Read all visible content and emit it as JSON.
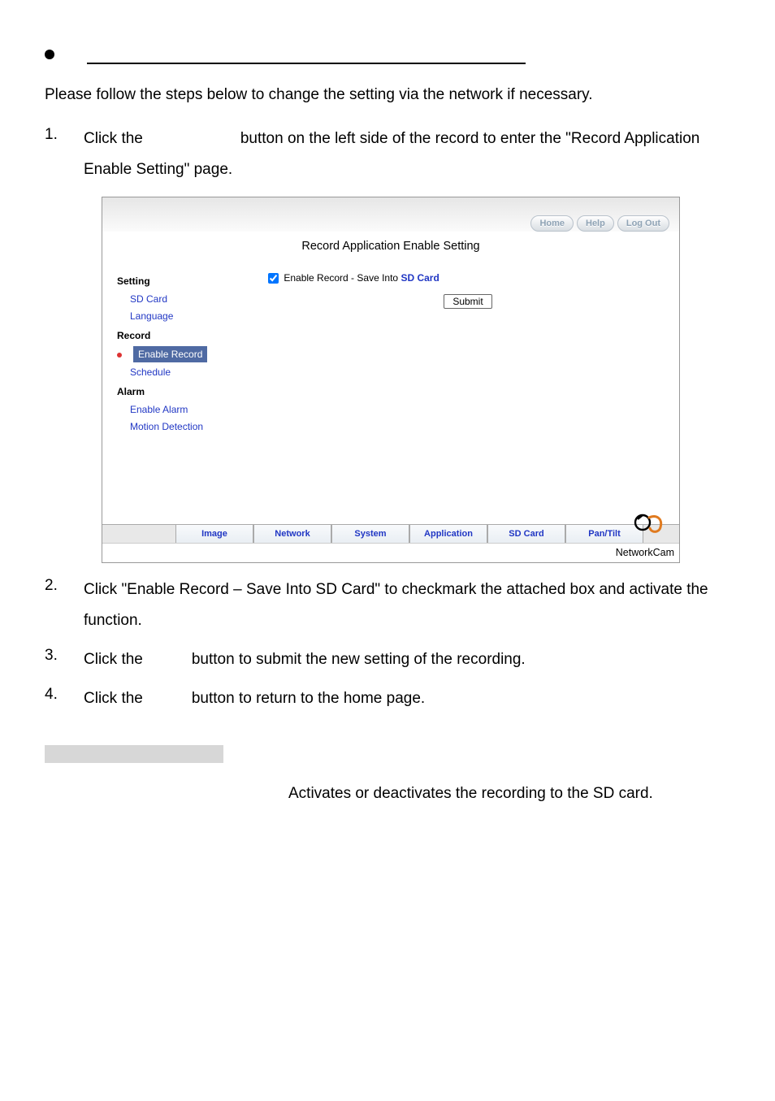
{
  "intro_text": "Please follow the steps below to change the setting via the network if necessary.",
  "steps": {
    "s1a": "Click the",
    "s1b": "button on the left side of the record to enter the \"Record Application",
    "s1c": "Enable Setting\" page.",
    "s2": "Click \"Enable Record – Save Into SD Card\" to checkmark the attached box and activate the function.",
    "s3a": "Click the",
    "s3b": "button to submit the new setting of the recording.",
    "s4a": "Click the",
    "s4b": "button to return to the home page."
  },
  "screenshot": {
    "pill_home": "Home",
    "pill_help": "Help",
    "pill_logout": "Log Out",
    "title": "Record Application Enable Setting",
    "side": {
      "setting": "Setting",
      "sd_card": "SD Card",
      "language": "Language",
      "record": "Record",
      "enable_record": "Enable Record",
      "schedule": "Schedule",
      "alarm": "Alarm",
      "enable_alarm": "Enable Alarm",
      "motion_detection": "Motion Detection"
    },
    "main": {
      "checkbox_label_a": "Enable Record - Save Into ",
      "checkbox_label_b": "SD Card",
      "submit": "Submit"
    },
    "tabs": {
      "image": "Image",
      "network": "Network",
      "system": "System",
      "application": "Application",
      "sd_card": "SD Card",
      "pan_tilt": "Pan/Tilt"
    },
    "footer_brand": "NetworkCam"
  },
  "description_text": "Activates or deactivates the recording to the SD card."
}
